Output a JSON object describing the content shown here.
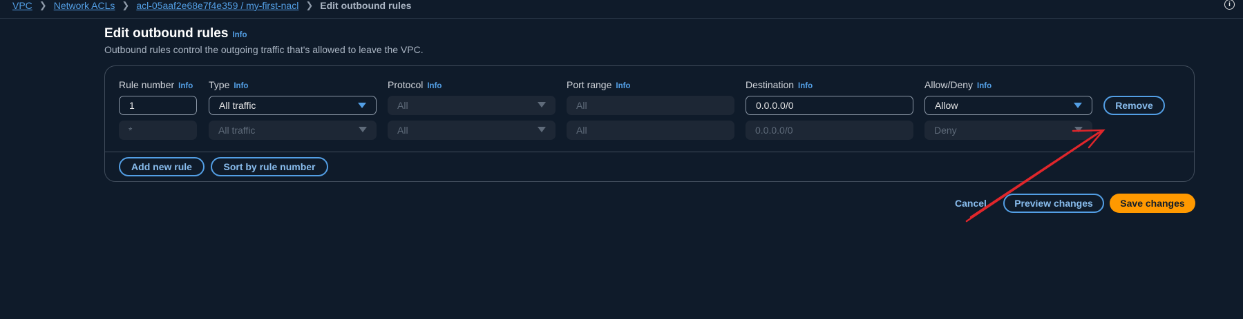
{
  "breadcrumb": {
    "items": [
      "VPC",
      "Network ACLs",
      "acl-05aaf2e68e7f4e359 / my-first-nacl"
    ],
    "current": "Edit outbound rules"
  },
  "header": {
    "title": "Edit outbound rules",
    "info": "Info",
    "description": "Outbound rules control the outgoing traffic that's allowed to leave the VPC."
  },
  "columns": {
    "rule_number": "Rule number",
    "type": "Type",
    "protocol": "Protocol",
    "port_range": "Port range",
    "destination": "Destination",
    "allow_deny": "Allow/Deny",
    "info": "Info"
  },
  "rules": [
    {
      "rule_number": "1",
      "type": "All traffic",
      "protocol": "All",
      "port_range": "All",
      "destination": "0.0.0.0/0",
      "action": "Allow",
      "remove_label": "Remove"
    },
    {
      "rule_number": "*",
      "type": "All traffic",
      "protocol": "All",
      "port_range": "All",
      "destination": "0.0.0.0/0",
      "action": "Deny"
    }
  ],
  "actions": {
    "add_rule": "Add new rule",
    "sort": "Sort by rule number",
    "cancel": "Cancel",
    "preview": "Preview changes",
    "save": "Save changes"
  },
  "icons": {
    "info_corner": "info-circle-icon",
    "caret": "caret-down-icon",
    "separator": "chevron-right-icon"
  },
  "colors": {
    "background": "#0f1b2a",
    "link": "#539fe5",
    "primary": "#ff9900",
    "annotation_arrow": "#e0262b"
  }
}
